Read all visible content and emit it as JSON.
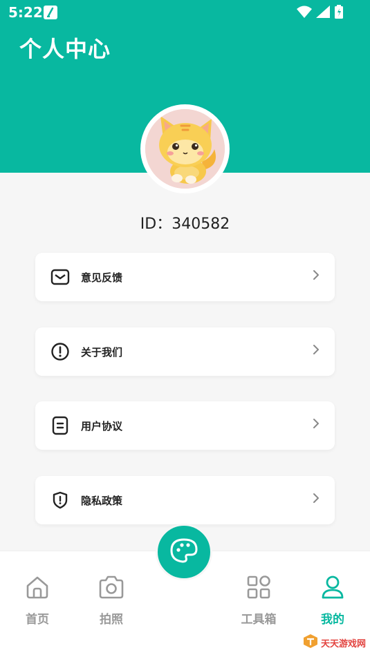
{
  "status_bar": {
    "time": "5:22"
  },
  "header": {
    "title": "个人中心"
  },
  "profile": {
    "id_text": "ID：340582"
  },
  "menu": [
    {
      "label": "意见反馈",
      "icon": "mail-icon"
    },
    {
      "label": "关于我们",
      "icon": "info-icon"
    },
    {
      "label": "用户协议",
      "icon": "document-icon"
    },
    {
      "label": "隐私政策",
      "icon": "shield-icon"
    }
  ],
  "tabs": [
    {
      "label": "首页",
      "icon": "home-icon",
      "active": false
    },
    {
      "label": "拍照",
      "icon": "camera-icon",
      "active": false
    },
    {
      "label": "工具箱",
      "icon": "grid-icon",
      "active": false
    },
    {
      "label": "我的",
      "icon": "user-icon",
      "active": true
    }
  ],
  "center_button": {
    "icon": "palette-icon"
  },
  "watermark": {
    "text": "天天游戏网"
  },
  "colors": {
    "accent": "#08b8a0",
    "background": "#f6f6f6",
    "inactive": "#999999"
  }
}
